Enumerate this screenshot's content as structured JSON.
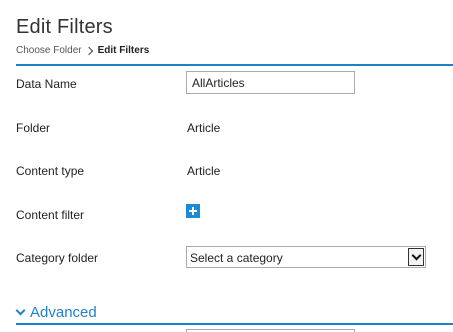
{
  "page": {
    "title": "Edit Filters"
  },
  "breadcrumb": {
    "items": [
      "Choose Folder",
      "Edit Filters"
    ]
  },
  "form": {
    "data_name": {
      "label": "Data Name",
      "value": "AllArticles"
    },
    "folder": {
      "label": "Folder",
      "value": "Article"
    },
    "content_type": {
      "label": "Content type",
      "value": "Article"
    },
    "content_filter": {
      "label": "Content filter",
      "button_icon": "plus-icon"
    },
    "category_folder": {
      "label": "Category folder",
      "selected": "Select a category"
    }
  },
  "advanced": {
    "label": "Advanced",
    "icon": "chevron-down-icon"
  },
  "colors": {
    "accent": "#1f82c9",
    "add_button": "#1e8ad6"
  }
}
